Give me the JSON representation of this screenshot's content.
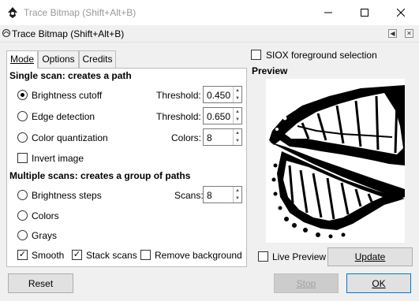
{
  "window": {
    "title": "Trace Bitmap (Shift+Alt+B)",
    "controls": [
      "minimize-icon",
      "maximize-icon",
      "close-icon"
    ]
  },
  "dock": {
    "title": "Trace Bitmap (Shift+Alt+B)",
    "buttons": [
      "iconify-icon",
      "close-icon"
    ]
  },
  "tabs": [
    {
      "label": "Mode",
      "active": true
    },
    {
      "label": "Options",
      "active": false
    },
    {
      "label": "Credits",
      "active": false
    }
  ],
  "single_scan": {
    "header": "Single scan: creates a path",
    "options": [
      {
        "label": "Brightness cutoff",
        "checked": true,
        "param_label": "Threshold:",
        "param_value": "0.450"
      },
      {
        "label": "Edge detection",
        "checked": false,
        "param_label": "Threshold:",
        "param_value": "0.650"
      },
      {
        "label": "Color quantization",
        "checked": false,
        "param_label": "Colors:",
        "param_value": "8"
      }
    ],
    "invert_label": "Invert image",
    "invert_checked": false
  },
  "multiple_scans": {
    "header": "Multiple scans: creates a group of paths",
    "options": [
      {
        "label": "Brightness steps",
        "checked": false
      },
      {
        "label": "Colors",
        "checked": false
      },
      {
        "label": "Grays",
        "checked": false
      }
    ],
    "scans_label": "Scans:",
    "scans_value": "8",
    "smooth_label": "Smooth",
    "smooth_checked": true,
    "stack_label": "Stack scans",
    "stack_checked": true,
    "remove_bg_label": "Remove background",
    "remove_bg_checked": false
  },
  "siox": {
    "label": "SIOX foreground selection",
    "checked": false
  },
  "preview": {
    "header": "Preview",
    "live_label": "Live Preview",
    "live_checked": false,
    "update_label": "Update"
  },
  "footer": {
    "reset_label": "Reset",
    "stop_label": "Stop",
    "ok_label": "OK"
  },
  "colors": {
    "accent": "#0078d7",
    "panel_bg": "#f0f0f0"
  }
}
